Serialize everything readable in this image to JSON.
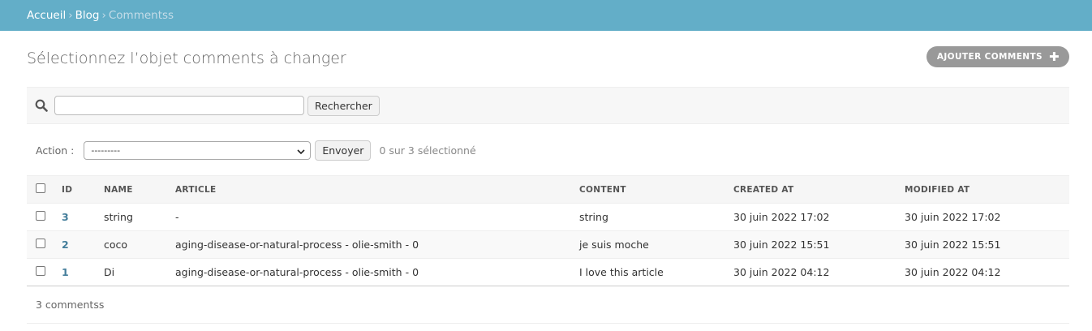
{
  "breadcrumbs": {
    "home": "Accueil",
    "app": "Blog",
    "current": "Commentss",
    "separator": "›"
  },
  "page": {
    "title": "Sélectionnez l’objet comments à changer",
    "add_button": "AJOUTER COMMENTS"
  },
  "search": {
    "value": "",
    "button": "Rechercher"
  },
  "actions": {
    "label": "Action :",
    "selected": "---------",
    "go_button": "Envoyer",
    "counter": "0 sur 3 sélectionné"
  },
  "table": {
    "headers": {
      "id": "ID",
      "name": "NAME",
      "article": "ARTICLE",
      "content": "CONTENT",
      "created_at": "CREATED AT",
      "modified_at": "MODIFIED AT"
    },
    "rows": [
      {
        "id": "3",
        "name": "string",
        "article": "-",
        "content": "string",
        "created_at": "30 juin 2022 17:02",
        "modified_at": "30 juin 2022 17:02"
      },
      {
        "id": "2",
        "name": "coco",
        "article": "aging-disease-or-natural-process - olie-smith - 0",
        "content": "je suis moche",
        "created_at": "30 juin 2022 15:51",
        "modified_at": "30 juin 2022 15:51"
      },
      {
        "id": "1",
        "name": "Di",
        "article": "aging-disease-or-natural-process - olie-smith - 0",
        "content": "I love this article",
        "created_at": "30 juin 2022 04:12",
        "modified_at": "30 juin 2022 04:12"
      }
    ]
  },
  "paginator": {
    "count_text": "3 commentss"
  },
  "colors": {
    "header_bg": "#63aec8",
    "link": "#447e9b",
    "add_button_bg": "#999999"
  },
  "icons": {
    "search": "search-icon",
    "add": "plus-icon",
    "dropdown": "chevron-down-icon"
  }
}
